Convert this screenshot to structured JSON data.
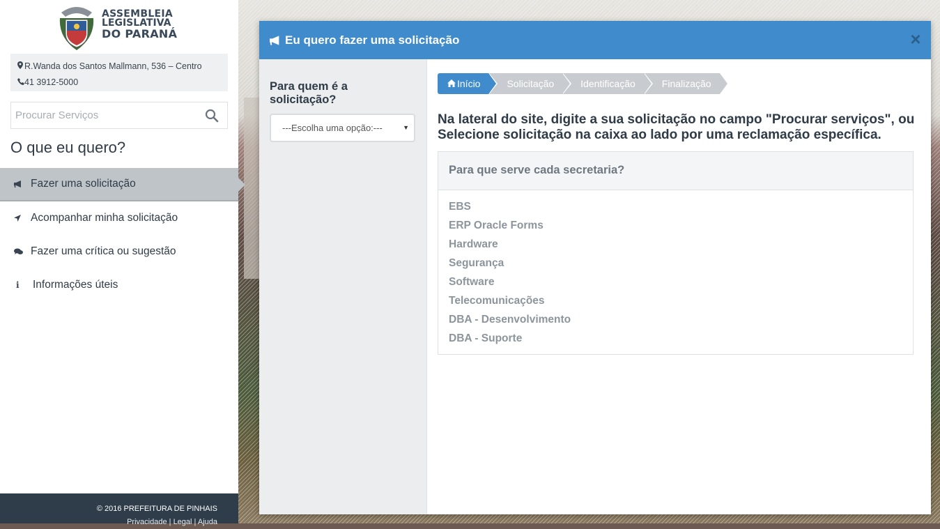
{
  "org": {
    "line1": "ASSEMBLEIA",
    "line2": "LEGISLATIVA",
    "line3": "DO PARANÁ"
  },
  "contact": {
    "address": "R.Wanda dos Santos Mallmann, 536 – Centro",
    "phone": "41 3912-5000"
  },
  "search": {
    "placeholder": "Procurar Serviços"
  },
  "sidebar": {
    "title": "O que eu quero?",
    "items": [
      {
        "label": "Fazer uma solicitação",
        "icon": "bullhorn-icon"
      },
      {
        "label": "Acompanhar minha solicitação",
        "icon": "location-arrow-icon"
      },
      {
        "label": "Fazer uma crítica ou sugestão",
        "icon": "comments-icon"
      },
      {
        "label": "Informações úteis",
        "icon": "info-icon"
      }
    ]
  },
  "footer": {
    "copyright": "© 2016 PREFEITURA DE PINHAIS",
    "privacy": "Privacidade",
    "legal": "Legal",
    "help": "Ajuda",
    "sep": "|"
  },
  "modal": {
    "title": "Eu quero fazer uma solicitação",
    "close": "×",
    "question": "Para quem é a solicitação?",
    "select_value": "---Escolha uma opção:---",
    "steps": [
      "Início",
      "Solicitação",
      "Identificação",
      "Finalização"
    ],
    "instructions": "Na lateral do site, digite a sua solicitação no campo \"Procurar serviços\", ou Selecione solicitação na caixa ao lado por uma reclamação específica.",
    "panel_title": "Para que serve cada secretaria?",
    "departments": [
      "EBS",
      "ERP Oracle Forms",
      "Hardware",
      "Segurança",
      "Software",
      "Telecomunicações",
      "DBA - Desenvolvimento",
      "DBA - Suporte"
    ]
  },
  "colors": {
    "primary": "#3f8bcb",
    "sidebar_active": "#bfc4c8",
    "footer_bg": "#2f3d4a",
    "text_dark": "#2f3b47"
  }
}
